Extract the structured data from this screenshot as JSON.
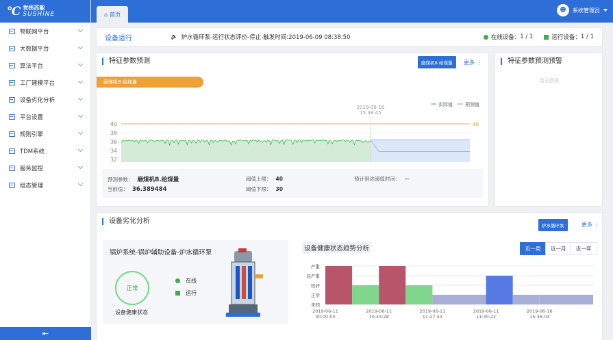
{
  "brand": {
    "cn": "世纬苏能",
    "en": "SUSHINE"
  },
  "sidebar": {
    "items": [
      {
        "label": "物联网平台"
      },
      {
        "label": "大数据平台"
      },
      {
        "label": "算法平台"
      },
      {
        "label": "工厂建模平台"
      },
      {
        "label": "设备劣化分析"
      },
      {
        "label": "平台设置"
      },
      {
        "label": "规则引擎"
      },
      {
        "label": "TDM系统"
      },
      {
        "label": "服务监控"
      },
      {
        "label": "组态管理"
      }
    ],
    "collapse_icon": "collapse-icon"
  },
  "header": {
    "home_tab": "首页",
    "user": "系统管理员"
  },
  "status": {
    "title": "设备运行",
    "alarm": "炉水循环泵-运行状态评价-停止-触发时间:2019-06-09 08:38:50",
    "online_label": "在线设备：",
    "online_value": "1 / 1",
    "running_label": "运行设备：",
    "running_value": "1 / 1",
    "online_color": "#35b34a",
    "running_color": "#35b34a"
  },
  "predict": {
    "title": "特征参数预测",
    "button": "磨煤机B.给煤量",
    "more": "更多",
    "tag": "磨煤机B.给煤量",
    "legend_actual": "实际值",
    "legend_predict": "预测值",
    "param_label": "预测参数：",
    "param_value": "磨煤机B.给煤量",
    "current_label": "当前值：",
    "current_value": "36.389484",
    "upper_label": "阈值上限：",
    "upper_value": "40",
    "lower_label": "阈值下限：",
    "lower_value": "30",
    "reach_label": "预计到达阈值时间：",
    "reach_value": "—"
  },
  "warn": {
    "title": "特征参数预测预警",
    "empty": "暂无数据"
  },
  "deg": {
    "title": "设备劣化分析",
    "button": "炉水循环泵",
    "more": "更多",
    "system": "锅炉系统-锅炉辅助设备-炉水循环泵",
    "status_circle": "正常",
    "health_label": "设备健康状态",
    "legend_online": "在线",
    "legend_running": "运行",
    "trend_title": "设备健康状态趋势分析",
    "range": [
      "近一周",
      "近一月",
      "近一年"
    ]
  },
  "chart_data": [
    {
      "type": "line",
      "title": "",
      "xlabel": "",
      "ylabel": "",
      "ylim": [
        30,
        40
      ],
      "ticks_y": [
        30,
        32,
        34,
        36,
        38,
        40
      ],
      "cursor_label": "2019-06-16 15:38:45",
      "x_tick_labels": [
        "2019-06-16 13:38:10",
        "2019-06-16 14:00:00",
        "2019-06-16 16:00:00",
        "2019-06-16 18:00:00",
        "2019-06-16 18:38:05"
      ],
      "threshold_upper": 40,
      "threshold_lower": 30,
      "threshold_color": "#f08c3a",
      "series": [
        {
          "name": "实际值",
          "color": "#35b34a",
          "range": [
            35.2,
            36.4
          ]
        },
        {
          "name": "预测值",
          "color": "#6aa0e0",
          "range": [
            33.8,
            36.4
          ]
        }
      ]
    },
    {
      "type": "bar",
      "title": "",
      "xlabel": "",
      "ylabel": "",
      "y_categories": [
        "未知",
        "正常",
        "较好",
        "轻严重",
        "严重"
      ],
      "categories": [
        "2019-06-11 00:00:00",
        "2019-06-11 10:44:28",
        "2019-06-11 11:27:43",
        "2019-06-11 11:30:22",
        "2019-06-16 15:36:04"
      ],
      "bars": [
        {
          "level": 4,
          "color": "#b8556a"
        },
        {
          "level": 2,
          "color": "#7fd68c"
        },
        {
          "level": 4,
          "color": "#b8556a"
        },
        {
          "level": 2,
          "color": "#7fd68c"
        },
        {
          "level": 1,
          "color": "#a9aed6"
        },
        {
          "level": 1,
          "color": "#a9aed6"
        },
        {
          "level": 3,
          "color": "#5779e3"
        },
        {
          "level": 1,
          "color": "#a9aed6"
        },
        {
          "level": 1,
          "color": "#a9aed6"
        },
        {
          "level": 1,
          "color": "#a9aed6"
        }
      ]
    }
  ]
}
